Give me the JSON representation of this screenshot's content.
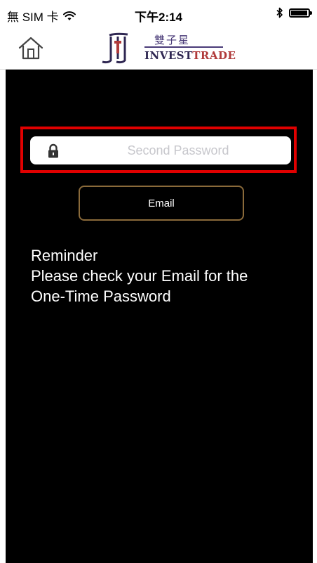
{
  "status_bar": {
    "carrier": "無 SIM 卡",
    "time": "下午2:14",
    "battery_level": 0.95
  },
  "header": {
    "home_icon": "home-icon",
    "logo": {
      "chinese_name": "雙子星",
      "english_name_part1": "INVEST",
      "english_name_part2": "TRADE"
    }
  },
  "form": {
    "second_password_placeholder": "Second Password",
    "second_password_value": "",
    "lock_icon": "lock-icon",
    "email_button_label": "Email"
  },
  "reminder": {
    "title": "Reminder",
    "line1": "Please check your Email for the",
    "line2": "One-Time Password"
  },
  "colors": {
    "background": "#000000",
    "highlight_border": "#e00000",
    "button_border": "#8a6a3a",
    "logo_purple": "#4a3b78",
    "logo_red": "#b03a3a"
  }
}
